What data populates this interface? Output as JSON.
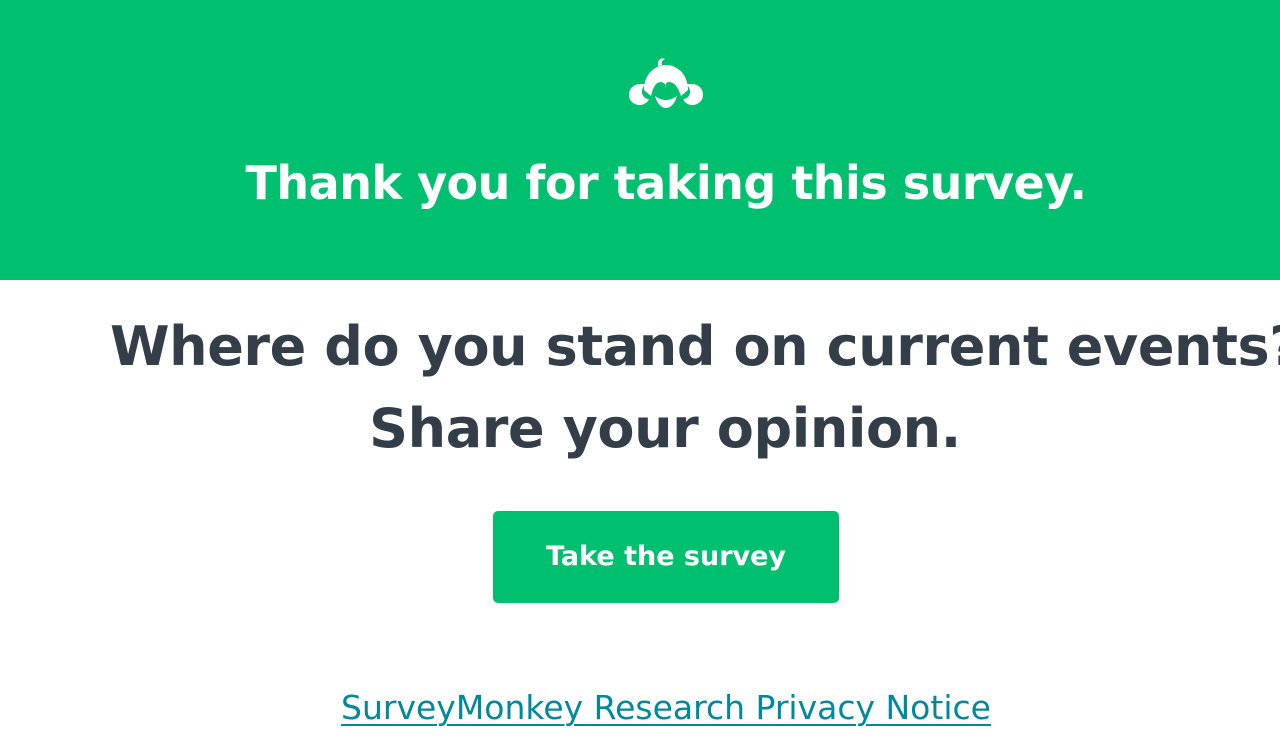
{
  "header": {
    "logo_icon": "surveymonkey-logo-icon",
    "title": "Thank you for taking this survey.",
    "background_color": "#00bf6f"
  },
  "main": {
    "headline_line1": "Where do you stand on current events?",
    "headline_line2": "Share your opinion.",
    "cta_label": "Take the survey",
    "cta_color": "#00bf6f"
  },
  "footer": {
    "privacy_link": "SurveyMonkey Research Privacy Notice",
    "link_color": "#00899a"
  }
}
